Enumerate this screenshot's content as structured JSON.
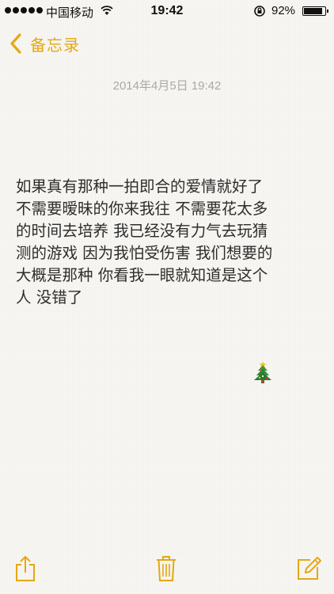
{
  "status_bar": {
    "carrier": "中国移动",
    "time": "19:42",
    "battery_percent": "92%",
    "battery_level": 0.92
  },
  "nav": {
    "back_label": "备忘录"
  },
  "note": {
    "date": "2014年4月5日 19:42",
    "lines": [
      "如果真有那种一拍即合的爱情就好了",
      "不需要暧昧的你来我往 不需要花太多",
      "的时间去培养 我已经没有力气去玩猜",
      "测的游戏 因为我怕受伤害 我们想要的",
      "大概是那种 你看我一眼就知道是这个",
      "人 没错了"
    ],
    "emoji": "christmas-tree"
  },
  "toolbar": {
    "share_icon": "share-icon",
    "trash_icon": "trash-icon",
    "compose_icon": "compose-icon"
  },
  "colors": {
    "accent": "#e5a812",
    "background": "#f7f6f2",
    "date_text": "#a9a9a9"
  }
}
